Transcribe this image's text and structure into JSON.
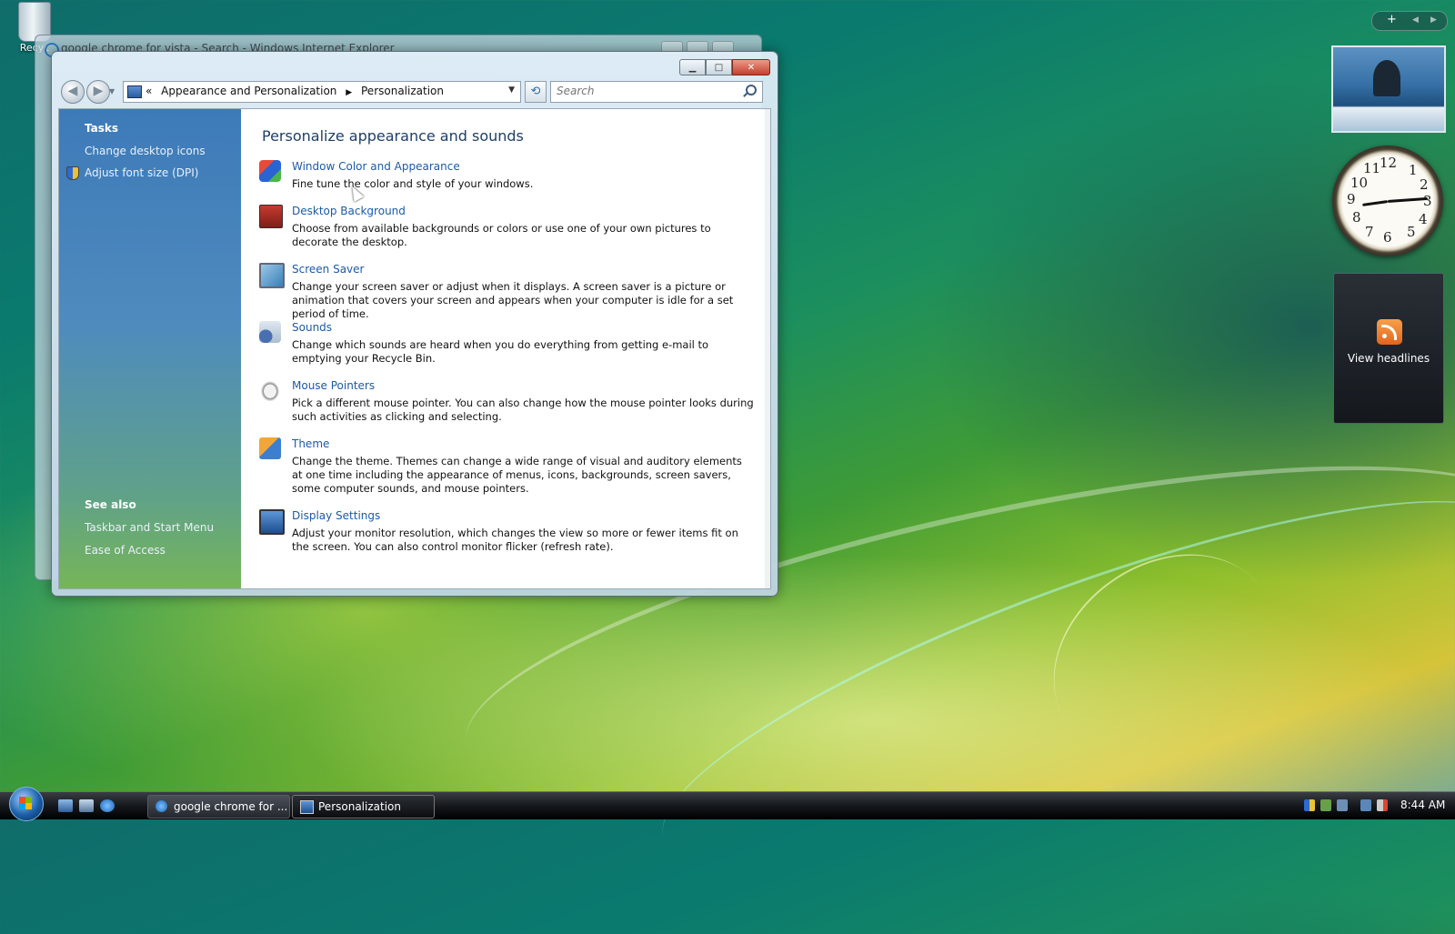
{
  "desktop": {
    "recycle_bin_label": "Recyc"
  },
  "background_window": {
    "title": "google chrome for vista - Search - Windows Internet Explorer"
  },
  "window": {
    "address": {
      "overflow": "«",
      "crumbs": [
        "Appearance and Personalization",
        "Personalization"
      ]
    },
    "search_placeholder": "Search",
    "sidebar": {
      "tasks_heading": "Tasks",
      "tasks": [
        "Change desktop icons",
        "Adjust font size (DPI)"
      ],
      "see_also_heading": "See also",
      "see_also": [
        "Taskbar and Start Menu",
        "Ease of Access"
      ]
    },
    "main": {
      "title": "Personalize appearance and sounds",
      "items": [
        {
          "icon": "window-color-icon",
          "link": "Window Color and Appearance",
          "desc": "Fine tune the color and style of your windows."
        },
        {
          "icon": "desktop-background-icon",
          "link": "Desktop Background",
          "desc": "Choose from available backgrounds or colors or use one of your own pictures to decorate the desktop."
        },
        {
          "icon": "screen-saver-icon",
          "link": "Screen Saver",
          "desc": "Change your screen saver or adjust when it displays. A screen saver is a picture or animation that covers your screen and appears when your computer is idle for a set period of time."
        },
        {
          "icon": "sounds-icon",
          "link": "Sounds",
          "desc": "Change which sounds are heard when you do everything from getting e-mail to emptying your Recycle Bin."
        },
        {
          "icon": "mouse-pointers-icon",
          "link": "Mouse Pointers",
          "desc": "Pick a different mouse pointer. You can also change how the mouse pointer looks during such activities as clicking and selecting."
        },
        {
          "icon": "theme-icon",
          "link": "Theme",
          "desc": "Change the theme. Themes can change a wide range of visual and auditory elements at one time including the appearance of menus, icons, backgrounds, screen savers, some computer sounds, and mouse pointers."
        },
        {
          "icon": "display-settings-icon",
          "link": "Display Settings",
          "desc": "Adjust your monitor resolution, which changes the view so more or fewer items fit on the screen. You can also control monitor flicker (refresh rate)."
        }
      ]
    }
  },
  "gadgets": {
    "feed_label": "View headlines",
    "clock_numbers": [
      "12",
      "1",
      "2",
      "3",
      "4",
      "5",
      "6",
      "7",
      "8",
      "9",
      "10",
      "11"
    ]
  },
  "taskbar": {
    "tasks": [
      "google chrome for ...",
      "Personalization"
    ],
    "time": "8:44 AM"
  },
  "colors": {
    "link": "#1c5aa6",
    "title": "#1e3f67",
    "sidebar_top": "#3d7ab9",
    "sidebar_bottom": "#76b558"
  }
}
